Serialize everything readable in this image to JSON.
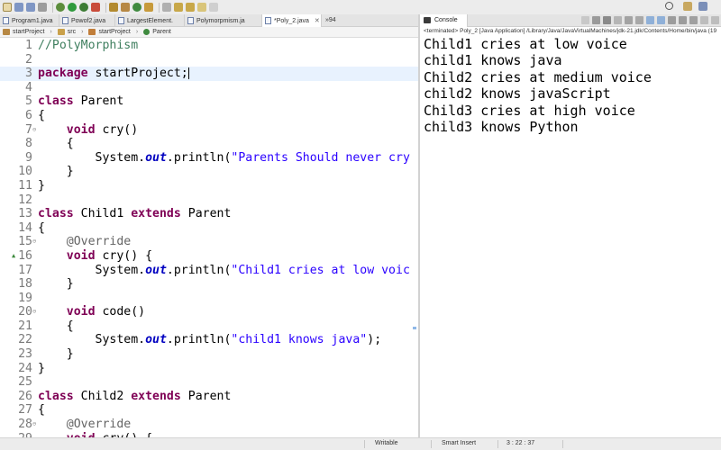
{
  "editor": {
    "tabs": [
      {
        "label": "Program1.java",
        "active": false
      },
      {
        "label": "Powof2.java",
        "active": false
      },
      {
        "label": "LargestElement.",
        "active": false
      },
      {
        "label": "Polymorpmism.ja",
        "active": false
      },
      {
        "label": "*Poly_2.java",
        "active": true
      }
    ],
    "tab_overflow": "»94",
    "breadcrumb": [
      "startProject",
      "src",
      "startProject",
      "Parent"
    ],
    "lines": [
      {
        "n": "1",
        "t": [
          [
            "cm",
            "//PolyMorphism"
          ]
        ]
      },
      {
        "n": "2",
        "t": []
      },
      {
        "n": "3",
        "t": [
          [
            "kw",
            "package"
          ],
          [
            "",
            " startProject;"
          ]
        ],
        "current": true,
        "caret": true
      },
      {
        "n": "4",
        "t": []
      },
      {
        "n": "5",
        "t": [
          [
            "kw",
            "class"
          ],
          [
            "",
            " Parent"
          ]
        ]
      },
      {
        "n": "6",
        "t": [
          [
            "",
            "{"
          ]
        ]
      },
      {
        "n": "7",
        "t": [
          [
            "",
            "    "
          ],
          [
            "kw",
            "void"
          ],
          [
            "",
            " cry()"
          ]
        ],
        "fold": true
      },
      {
        "n": "8",
        "t": [
          [
            "",
            "    {"
          ]
        ]
      },
      {
        "n": "9",
        "t": [
          [
            "",
            "        System."
          ],
          [
            "fi",
            "out"
          ],
          [
            "",
            ".println("
          ],
          [
            "st",
            "\"Parents Should never cry"
          ]
        ]
      },
      {
        "n": "10",
        "t": [
          [
            "",
            "    }"
          ]
        ]
      },
      {
        "n": "11",
        "t": [
          [
            "",
            "}"
          ]
        ]
      },
      {
        "n": "12",
        "t": []
      },
      {
        "n": "13",
        "t": [
          [
            "kw",
            "class"
          ],
          [
            "",
            " Child1 "
          ],
          [
            "kw",
            "extends"
          ],
          [
            "",
            " Parent"
          ]
        ]
      },
      {
        "n": "14",
        "t": [
          [
            "",
            "{"
          ]
        ]
      },
      {
        "n": "15",
        "t": [
          [
            "",
            "    "
          ],
          [
            "an",
            "@Override"
          ]
        ],
        "fold": true
      },
      {
        "n": "16",
        "t": [
          [
            "",
            "    "
          ],
          [
            "kw",
            "void"
          ],
          [
            "",
            " cry() {"
          ]
        ],
        "override": true
      },
      {
        "n": "17",
        "t": [
          [
            "",
            "        System."
          ],
          [
            "fi",
            "out"
          ],
          [
            "",
            ".println("
          ],
          [
            "st",
            "\"Child1 cries at low voic"
          ]
        ]
      },
      {
        "n": "18",
        "t": [
          [
            "",
            "    }"
          ]
        ]
      },
      {
        "n": "19",
        "t": []
      },
      {
        "n": "20",
        "t": [
          [
            "",
            "    "
          ],
          [
            "kw",
            "void"
          ],
          [
            "",
            " code()"
          ]
        ],
        "fold": true
      },
      {
        "n": "21",
        "t": [
          [
            "",
            "    {"
          ]
        ]
      },
      {
        "n": "22",
        "t": [
          [
            "",
            "        System."
          ],
          [
            "fi",
            "out"
          ],
          [
            "",
            ".println("
          ],
          [
            "st",
            "\"child1 knows java\""
          ],
          [
            "",
            ");"
          ]
        ]
      },
      {
        "n": "23",
        "t": [
          [
            "",
            "    }"
          ]
        ]
      },
      {
        "n": "24",
        "t": [
          [
            "",
            "}"
          ]
        ]
      },
      {
        "n": "25",
        "t": []
      },
      {
        "n": "26",
        "t": [
          [
            "kw",
            "class"
          ],
          [
            "",
            " Child2 "
          ],
          [
            "kw",
            "extends"
          ],
          [
            "",
            " Parent"
          ]
        ]
      },
      {
        "n": "27",
        "t": [
          [
            "",
            "{"
          ]
        ]
      },
      {
        "n": "28",
        "t": [
          [
            "",
            "    "
          ],
          [
            "an",
            "@Override"
          ]
        ],
        "fold": true
      },
      {
        "n": "29",
        "t": [
          [
            "",
            "    "
          ],
          [
            "kw",
            "void"
          ],
          [
            "",
            " cry() {"
          ]
        ]
      }
    ]
  },
  "console": {
    "tab_label": "Console",
    "status": "<terminated> Poly_2 [Java Application] /Library/Java/JavaVirtualMachines/jdk-21.jdk/Contents/Home/bin/java  (19",
    "output": [
      "Child1 cries at low voice",
      "child1 knows java",
      "Child2 cries at medium voice",
      "child2 knows javaScript",
      "Child3 cries at high voice",
      "child3 knows Python"
    ]
  },
  "statusbar": {
    "mode": "Writable",
    "insert": "Smart Insert",
    "position": "3 : 22 : 37"
  },
  "colors": {
    "keyword": "#7f0055",
    "string": "#2a00ff",
    "comment": "#3f7f5f",
    "annotation": "#646464",
    "field": "#0000c0",
    "current_line": "#e8f2fe"
  },
  "icons": {
    "toolbar": [
      "new-icon",
      "save-icon",
      "save-all-icon",
      "print-icon",
      "debug-icon",
      "run-icon",
      "coverage-icon",
      "external-tools-icon",
      "new-java-project-icon",
      "new-package-icon",
      "new-class-icon",
      "open-type-icon",
      "search-icon",
      "next-annotation-icon",
      "prev-annotation-icon",
      "back-icon",
      "forward-icon"
    ],
    "toolbar_right": [
      "search-icon",
      "perspective-icon",
      "java-perspective-icon"
    ]
  }
}
